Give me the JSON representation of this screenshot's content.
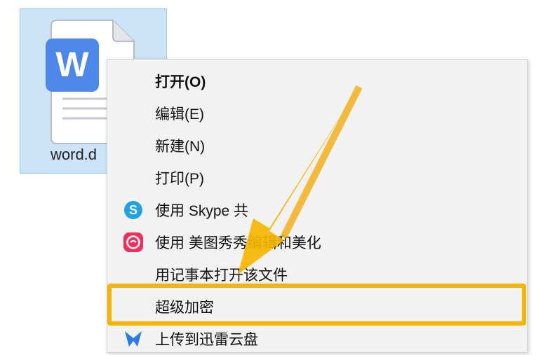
{
  "file": {
    "name": "word.d",
    "icon": "word-document-icon",
    "badge_letter": "W",
    "badge_color": "#4d87ea"
  },
  "menu": {
    "items": [
      {
        "label": "打开(O)",
        "bold": true
      },
      {
        "label": "编辑(E)"
      },
      {
        "label": "新建(N)"
      },
      {
        "label": "打印(P)"
      },
      {
        "label": "使用 Skype 共",
        "icon": "skype-icon"
      },
      {
        "label": "使用 美图秀秀编辑和美化",
        "icon": "meitu-icon"
      },
      {
        "label": "用记事本打开该文件"
      },
      {
        "label": "超级加密"
      },
      {
        "label": "上传到迅雷云盘",
        "icon": "thunder-icon"
      }
    ]
  },
  "colors": {
    "highlight": "#f7b500",
    "selection": "#cce4f7",
    "skype": "#1ea2e4",
    "meitu": "#f0305a"
  }
}
